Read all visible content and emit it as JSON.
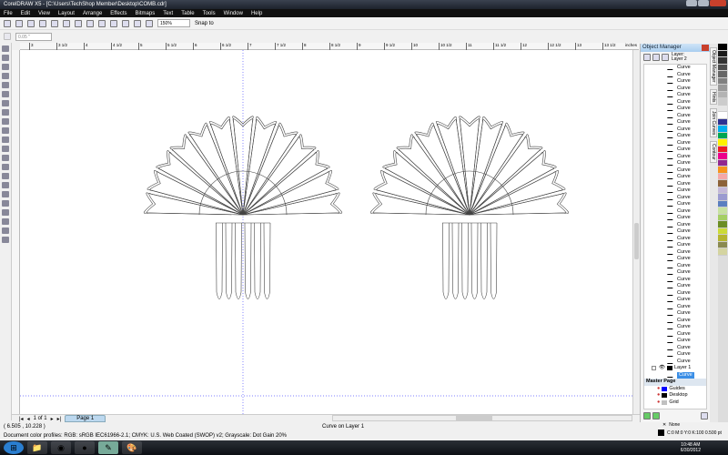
{
  "window": {
    "title": "CorelDRAW X5 - [C:\\Users\\TechShop Member\\Desktop\\COMB.cdr]"
  },
  "menu": [
    "File",
    "Edit",
    "View",
    "Layout",
    "Arrange",
    "Effects",
    "Bitmaps",
    "Text",
    "Table",
    "Tools",
    "Window",
    "Help"
  ],
  "toolbar": {
    "zoom": "150%",
    "snap": "Snap to",
    "nudge": "0.05 \""
  },
  "ruler": {
    "top_labels": [
      "3",
      "3 1/2",
      "4",
      "4 1/2",
      "5",
      "5 1/2",
      "6",
      "6 1/2",
      "7",
      "7 1/2",
      "8",
      "8 1/2",
      "9",
      "9 1/2",
      "10",
      "10 1/2",
      "11",
      "11 1/2",
      "12",
      "12 1/2",
      "13",
      "13 1/2"
    ],
    "units": "inches"
  },
  "page_nav": {
    "count": "1 of 1",
    "tab": "Page 1"
  },
  "status": {
    "coords": "( 6.505 , 10.228 )",
    "selection": "Curve on Layer 1",
    "color_profiles": "Document color profiles: RGB: sRGB IEC61966-2.1; CMYK: U.S. Web Coated (SWOP) v2; Grayscale: Dot Gain 20%",
    "fill": "None",
    "outline": "C:0 M:0 Y:0 K:100  0.500 pt"
  },
  "object_manager": {
    "title": "Object Manager",
    "layer_label": "Layer:",
    "layer_name": "Layer 2",
    "curve_label": "Curve",
    "curve_count": 44,
    "layer1": "Layer 1",
    "selected_curve": "Curve",
    "master_page": "Master Page",
    "master_layers": [
      {
        "name": "Guides",
        "color": "#0000ff"
      },
      {
        "name": "Desktop",
        "color": "#000000"
      },
      {
        "name": "Grid",
        "color": "#c0c0c0"
      }
    ]
  },
  "docker_tabs": [
    "Object Manager",
    "Hints",
    "Join Curves",
    "Contour"
  ],
  "palette": [
    "#000000",
    "#1a1a1a",
    "#333333",
    "#4d4d4d",
    "#666666",
    "#808080",
    "#999999",
    "#b3b3b3",
    "#cccccc",
    "#e6e6e6",
    "#ffffff",
    "#2e3192",
    "#00aeef",
    "#00a651",
    "#fff200",
    "#ed1c24",
    "#ec008c",
    "#92278f",
    "#f7941d",
    "#f5a8a8",
    "#8c6239",
    "#c4b8d9",
    "#9b9bd0",
    "#5b7fc0",
    "#c7e2a0",
    "#a5cf64",
    "#6b8e23",
    "#ccdb38",
    "#b5b530",
    "#8a8a50",
    "#d4d4a0"
  ],
  "clock": {
    "time": "10:48 AM",
    "date": "6/30/2012"
  }
}
